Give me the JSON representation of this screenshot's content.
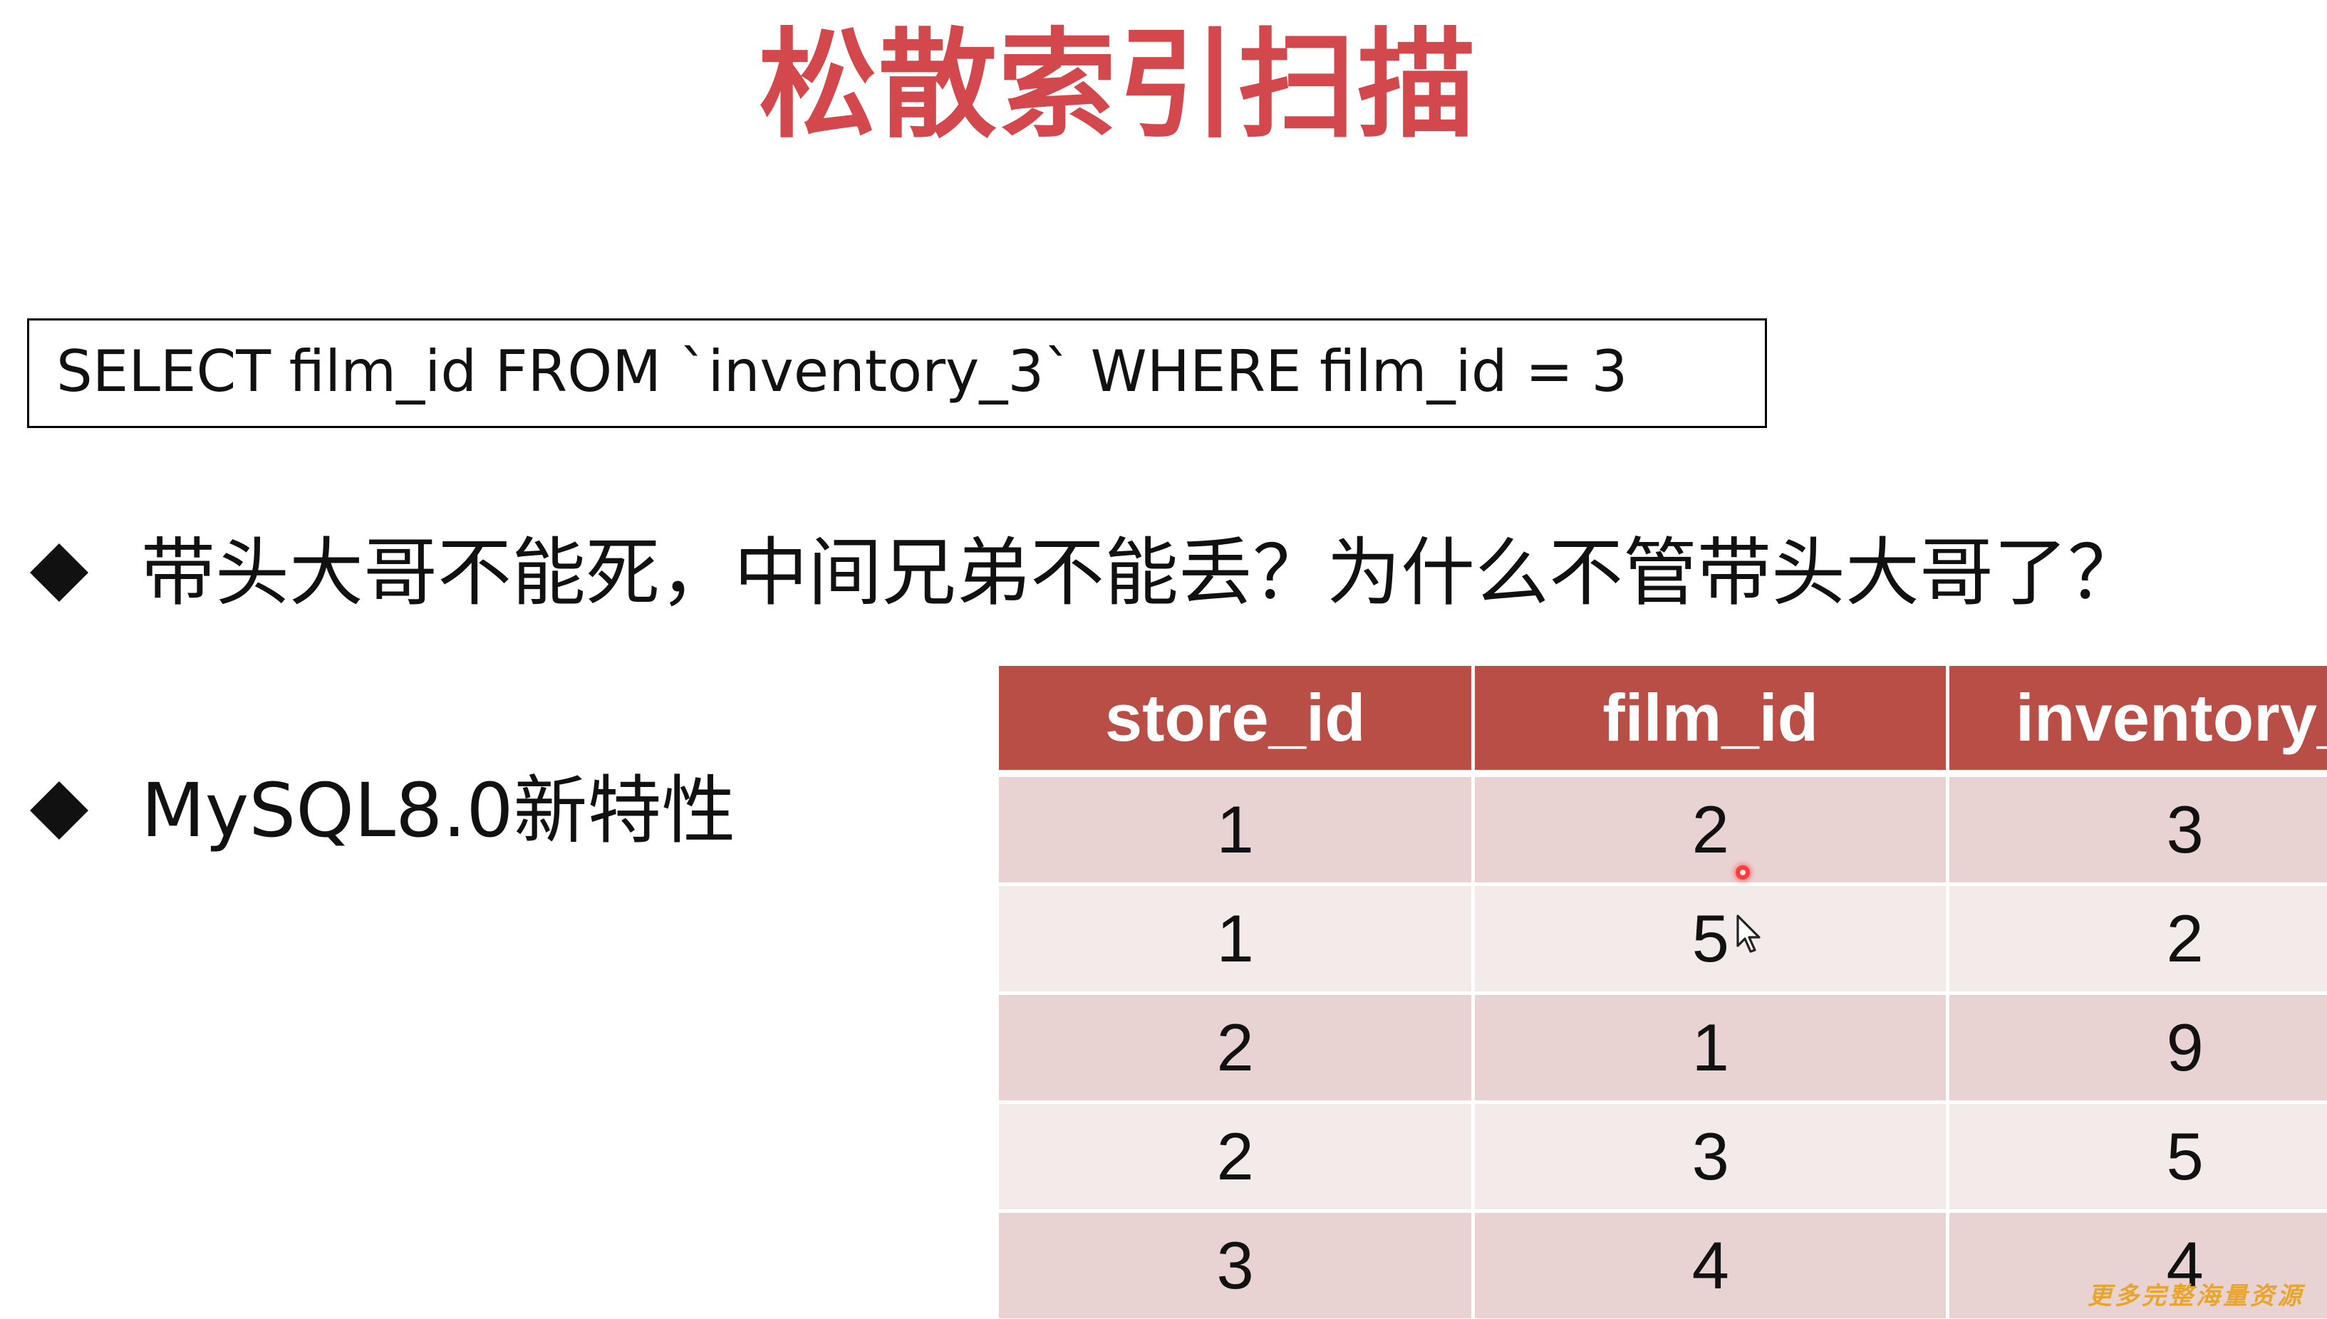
{
  "slide": {
    "title": "松散索引扫描",
    "sql_query": "SELECT film_id FROM `inventory_3` WHERE film_id = 3",
    "bullets": [
      {
        "text": "带头大哥不能死，中间兄弟不能丢？为什么不管带头大哥了？"
      },
      {
        "text": "MySQL8.0新特性"
      }
    ],
    "colors": {
      "title": "#d2484c",
      "table_header": "#b84e46",
      "row_odd": "#e8d2d2",
      "row_even": "#f3eaea"
    }
  },
  "table": {
    "headers": [
      "store_id",
      "film_id",
      "inventory_"
    ],
    "rows": [
      [
        "1",
        "2",
        "3"
      ],
      [
        "1",
        "5",
        "2"
      ],
      [
        "2",
        "1",
        "9"
      ],
      [
        "2",
        "3",
        "5"
      ],
      [
        "3",
        "4",
        "4"
      ]
    ]
  },
  "overlay": {
    "laser_pointer_icon": "laser-pointer-icon",
    "cursor_icon": "mouse-cursor-icon",
    "watermark_text": "更多完整海量资源"
  }
}
